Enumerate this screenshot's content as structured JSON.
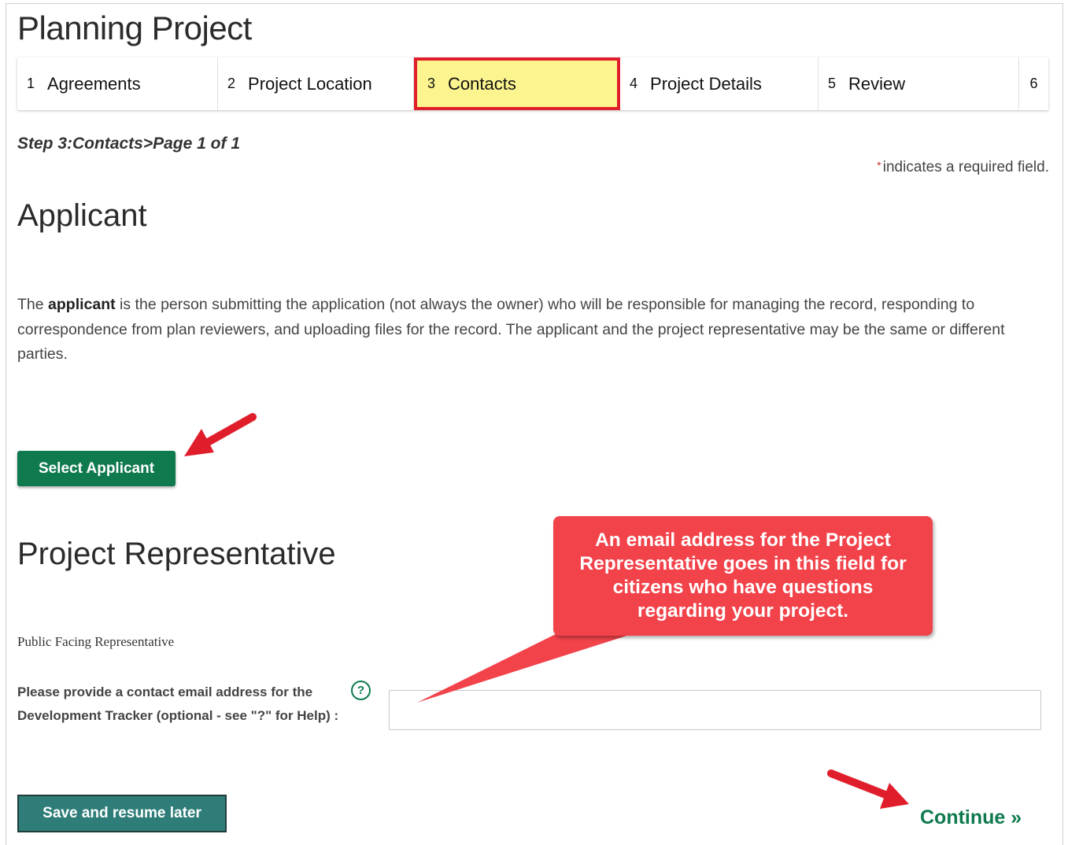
{
  "page": {
    "title": "Planning Project"
  },
  "steps": [
    {
      "num": "1",
      "label": "Agreements"
    },
    {
      "num": "2",
      "label": "Project Location"
    },
    {
      "num": "3",
      "label": "Contacts"
    },
    {
      "num": "4",
      "label": "Project Details"
    },
    {
      "num": "5",
      "label": "Review"
    },
    {
      "num": "6",
      "label": ""
    }
  ],
  "breadcrumb": "Step 3:Contacts>Page 1 of 1",
  "required_note": {
    "star": "*",
    "text": "indicates a required field."
  },
  "applicant": {
    "title": "Applicant",
    "intro_prefix": "The ",
    "intro_bold": "applicant",
    "intro_rest": " is the person submitting the application (not always the owner) who will be responsible for managing the record, responding to correspondence from plan reviewers, and uploading files for the record. The applicant and the project representative may be the same or different parties.",
    "select_button": "Select Applicant"
  },
  "representative": {
    "title": "Project Representative",
    "sub_label": "Public Facing Representative",
    "field_label": "Please provide a contact email address for the Development Tracker (optional - see \"?\" for Help) :",
    "help_glyph": "?",
    "email_value": ""
  },
  "callout": {
    "text": "An email address for the Project Representative goes in this field for citizens who have questions regarding your project."
  },
  "footer": {
    "save_label": "Save and resume later",
    "continue_label": "Continue »"
  },
  "colors": {
    "accent_green": "#0e7a4e",
    "highlight_yellow": "#fbf48f",
    "annotation_red": "#e01e2b",
    "callout_red": "#f2434b"
  }
}
